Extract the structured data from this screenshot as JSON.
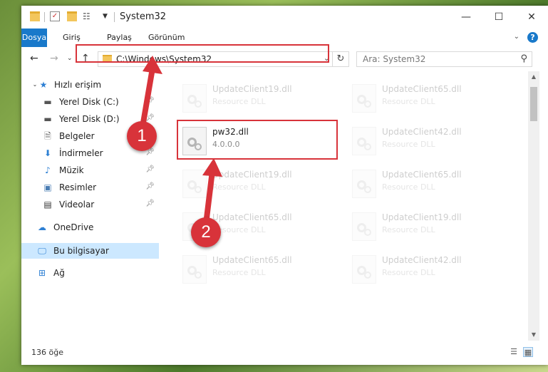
{
  "window": {
    "title": "System32"
  },
  "ribbon": {
    "tabs": [
      "Dosya",
      "Giriş",
      "Paylaş",
      "Görünüm"
    ],
    "help": "?"
  },
  "address": {
    "path": "C:\\Windows\\System32",
    "search_placeholder": "Ara: System32"
  },
  "sidebar": {
    "items": [
      {
        "label": "Hızlı erişim",
        "icon": "star-icon"
      },
      {
        "label": "Yerel Disk (C:)",
        "icon": "drive-icon"
      },
      {
        "label": "Yerel Disk (D:)",
        "icon": "drive-icon"
      },
      {
        "label": "Belgeler",
        "icon": "document-icon"
      },
      {
        "label": "İndirmeler",
        "icon": "download-icon"
      },
      {
        "label": "Müzik",
        "icon": "music-icon"
      },
      {
        "label": "Resimler",
        "icon": "picture-icon"
      },
      {
        "label": "Videolar",
        "icon": "video-icon"
      },
      {
        "label": "OneDrive",
        "icon": "cloud-icon"
      },
      {
        "label": "Bu bilgisayar",
        "icon": "computer-icon"
      },
      {
        "label": "Ağ",
        "icon": "network-icon"
      }
    ]
  },
  "files": {
    "highlighted": {
      "name": "pw32.dll",
      "sub": "4.0.0.0"
    },
    "left_column": [
      {
        "name": "UpdateClient19.dll",
        "sub": "Resource DLL"
      },
      {
        "name": "UpdateClient19.dll",
        "sub": "Resource DLL"
      },
      {
        "name": "UpdateClient65.dll",
        "sub": "Resource DLL"
      },
      {
        "name": "UpdateClient65.dll",
        "sub": "Resource DLL"
      }
    ],
    "right_column": [
      {
        "name": "UpdateClient65.dll",
        "sub": "Resource DLL"
      },
      {
        "name": "UpdateClient42.dll",
        "sub": "Resource DLL"
      },
      {
        "name": "UpdateClient65.dll",
        "sub": "Resource DLL"
      },
      {
        "name": "UpdateClient19.dll",
        "sub": "Resource DLL"
      },
      {
        "name": "UpdateClient42.dll",
        "sub": "Resource DLL"
      }
    ]
  },
  "status": {
    "count": "136 öğe"
  },
  "annotations": {
    "marker1": "1",
    "marker2": "2",
    "color": "#d8333a"
  }
}
